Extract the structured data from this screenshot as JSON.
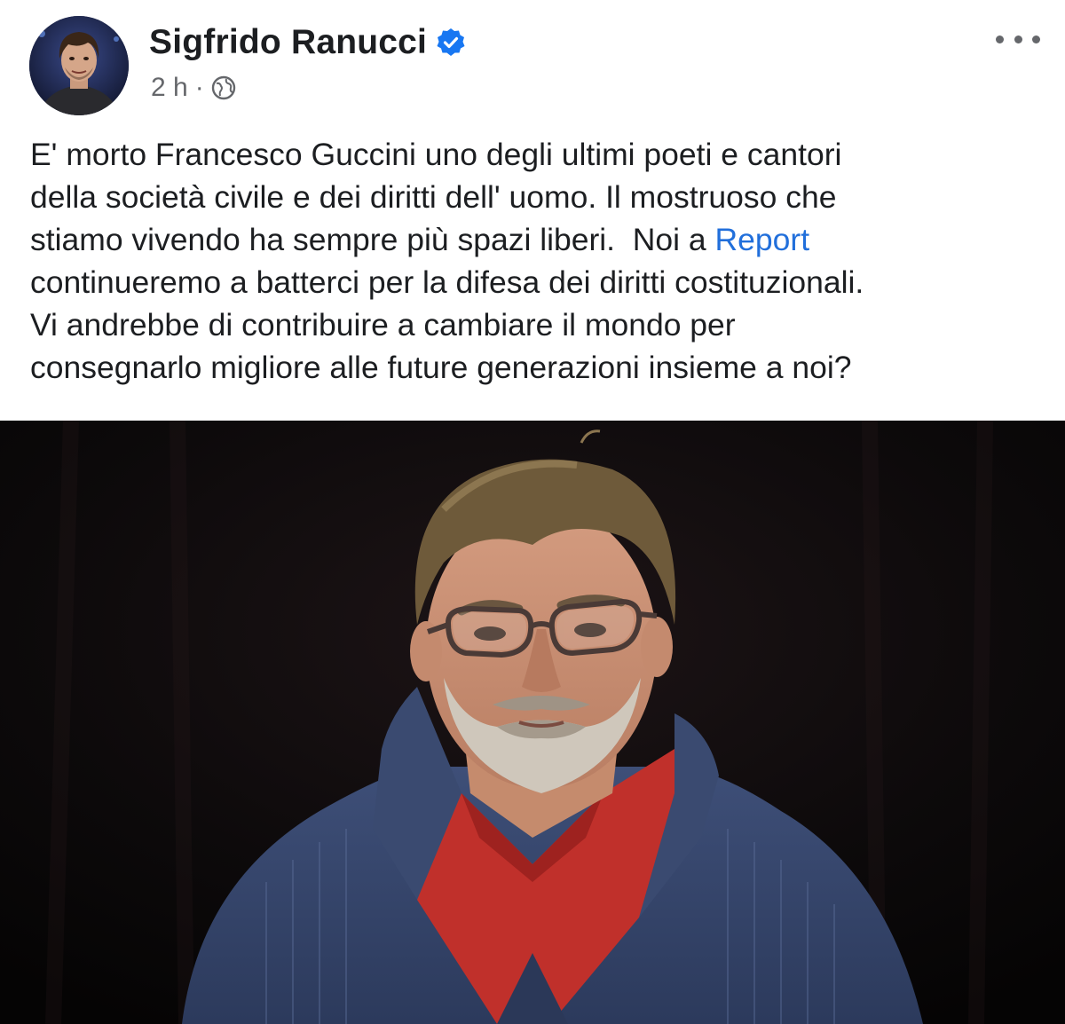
{
  "post": {
    "author": {
      "name": "Sigfrido Ranucci",
      "verified": true,
      "avatar_icon": "profile-photo"
    },
    "meta": {
      "time": "2 h",
      "separator": "·",
      "audience_icon": "globe-icon"
    },
    "more_icon": "more-horizontal-icon",
    "text": {
      "part1": "E' morto Francesco Guccini uno degli ultimi poeti e cantori\ndella società civile e dei diritti dell' uomo. Il mostruoso che\nstiamo vivendo ha sempre più spazi liberi.  Noi a ",
      "link": "Report",
      "part2": "\ncontinueremo a batterci per la difesa dei diritti costituzionali.\nVi andrebbe di contribuire a cambiare il mondo per\nconsegnarlo migliore alle future generazioni insieme a noi?"
    },
    "photo": {
      "subject": "portrait of an older man with glasses, grey beard, red shirt and blue knit sweater on a dark background"
    },
    "colors": {
      "link": "#216fdb",
      "verified": "#1877f2",
      "meta_text": "#65676b"
    }
  }
}
